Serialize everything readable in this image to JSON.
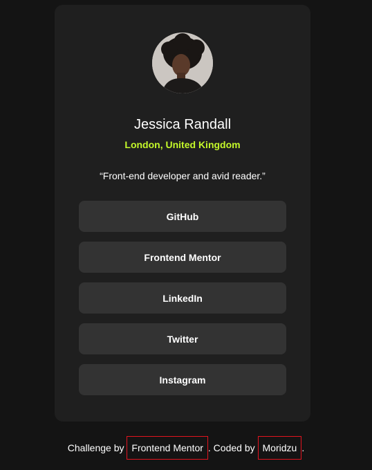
{
  "profile": {
    "avatar_alt": "Jessica Randall",
    "name": "Jessica Randall",
    "location": "London, United Kingdom",
    "bio": "“Front-end developer and avid reader.”"
  },
  "links": [
    {
      "label": "GitHub"
    },
    {
      "label": "Frontend Mentor"
    },
    {
      "label": "LinkedIn"
    },
    {
      "label": "Twitter"
    },
    {
      "label": "Instagram"
    }
  ],
  "attribution": {
    "prefix": "Challenge by ",
    "challenge_link": "Frontend Mentor",
    "middle": ". Coded by ",
    "author_link": "Moridzu",
    "suffix": "."
  },
  "colors": {
    "page_bg": "#141414",
    "card_bg": "#1f1f1f",
    "button_bg": "#333333",
    "accent": "#c4f82a",
    "link_outline": "#e3141f"
  }
}
